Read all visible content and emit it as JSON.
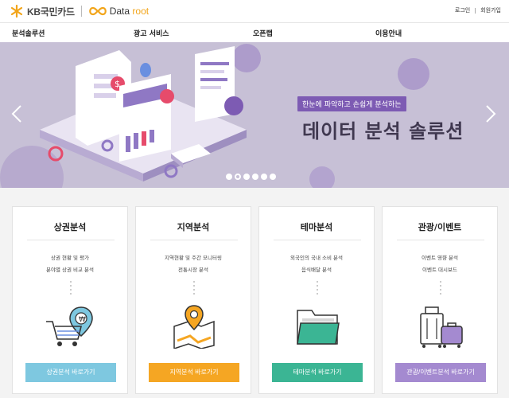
{
  "header": {
    "kb_label": "KB국민카드",
    "dataroot_prefix": "Data",
    "dataroot_suffix": "root",
    "login": "로그인",
    "signup": "회원가입"
  },
  "nav": {
    "items": [
      "분석솔루션",
      "광고 서비스",
      "오픈랩",
      "이용안내"
    ]
  },
  "banner": {
    "tagline": "한눈에 파악하고 손쉽게 분석하는",
    "title": "데이터 분석 솔루션",
    "slide_count": 6,
    "active_slide": 2
  },
  "cards": [
    {
      "title": "상권분석",
      "lines": [
        "상권 현황 및 평가",
        "분야별 상권 비교 분석"
      ],
      "button": "상권분석 바로가기",
      "color": "#7ec8e0"
    },
    {
      "title": "지역분석",
      "lines": [
        "지역현황 및 주간 모니터링",
        "전통시장 분석"
      ],
      "button": "지역분석 바로가기",
      "color": "#f5a623"
    },
    {
      "title": "테마분석",
      "lines": [
        "외국인의 국내 소비 분석",
        "음식배달 분석"
      ],
      "button": "테마분석 바로가기",
      "color": "#3bb594"
    },
    {
      "title": "관광/이벤트",
      "lines": [
        "이벤트 영향 분석",
        "이벤트 대시보드"
      ],
      "button": "관광/이벤트분석 바로가기",
      "color": "#a48ad0"
    }
  ],
  "colors": {
    "banner_bg": "#c7c0d6",
    "accent_purple": "#7d5bb3"
  }
}
